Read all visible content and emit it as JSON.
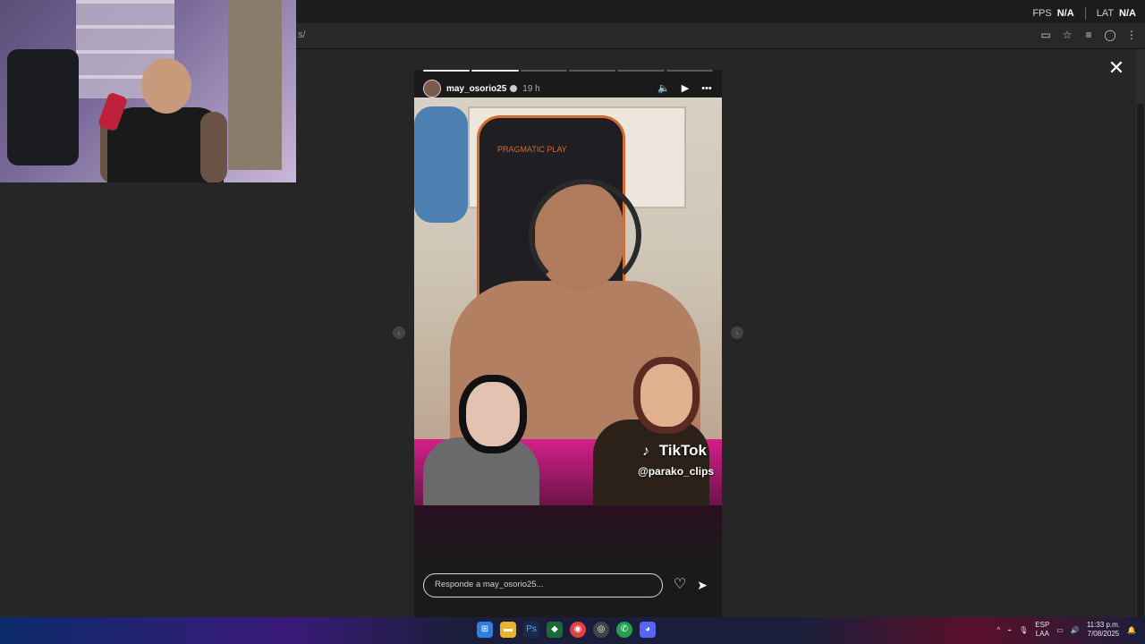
{
  "overlay": {
    "fps_label": "FPS",
    "fps_value": "N/A",
    "lat_label": "LAT",
    "lat_value": "N/A"
  },
  "browser": {
    "address_fragment": "s/"
  },
  "story": {
    "progress": {
      "segments": 6,
      "completed": 2
    },
    "username": "may_osorio25",
    "time_ago": "19 h",
    "watermark_brand": "TikTok",
    "watermark_handle": "@parako_clips",
    "chair_brand": "PRAGMATIC PLAY",
    "reply_placeholder": "Responde a may_osorio25..."
  },
  "taskbar": {
    "language_top": "ESP",
    "language_bottom": "LAA",
    "time": "11:33 p.m.",
    "date": "7/08/2025"
  },
  "icons": {
    "close": "close-icon",
    "mute": "volume-icon",
    "play": "play-icon",
    "more": "more-icon",
    "heart": "heart-icon",
    "send": "send-icon"
  }
}
